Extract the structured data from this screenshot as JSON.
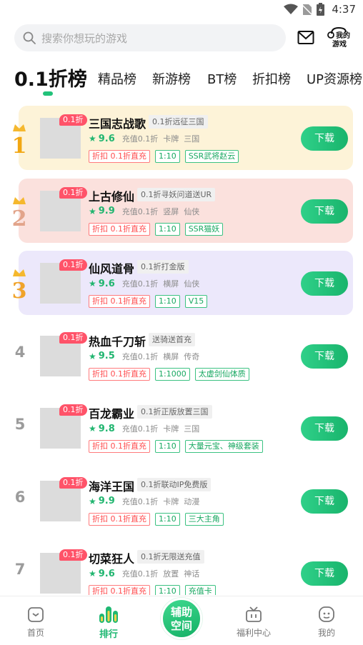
{
  "status": {
    "time": "4:37"
  },
  "search": {
    "placeholder": "搜索你想玩的游戏"
  },
  "header": {
    "my_games_line1": "我的",
    "my_games_line2": "游戏"
  },
  "tabs": [
    {
      "label": "0.1折榜",
      "active": true
    },
    {
      "label": "精品榜"
    },
    {
      "label": "新游榜"
    },
    {
      "label": "BT榜"
    },
    {
      "label": "折扣榜"
    },
    {
      "label": "UP资源榜"
    }
  ],
  "games": [
    {
      "rank": "1",
      "badge": "0.1折",
      "name": "三国志战歌",
      "subtitle": "0.1折远征三国",
      "score": "9.6",
      "meta": [
        "充值0.1折",
        "卡牌",
        "三国"
      ],
      "tags": [
        {
          "text": "折扣 0.1折直充",
          "color": "red"
        },
        {
          "text": "1:10",
          "color": "green"
        },
        {
          "text": "SSR武将赵云",
          "color": "green"
        }
      ],
      "button": "下载"
    },
    {
      "rank": "2",
      "badge": "0.1折",
      "name": "上古修仙",
      "subtitle": "0.1折寻妖问道送UR",
      "score": "9.9",
      "meta": [
        "充值0.1折",
        "竖屏",
        "仙侠"
      ],
      "tags": [
        {
          "text": "折扣 0.1折直充",
          "color": "red"
        },
        {
          "text": "1:10",
          "color": "green"
        },
        {
          "text": "SSR猫妖",
          "color": "green"
        }
      ],
      "button": "下载"
    },
    {
      "rank": "3",
      "badge": "0.1折",
      "name": "仙风道骨",
      "subtitle": "0.1折打金版",
      "score": "9.6",
      "meta": [
        "充值0.1折",
        "横屏",
        "仙侠"
      ],
      "tags": [
        {
          "text": "折扣 0.1折直充",
          "color": "red"
        },
        {
          "text": "1:10",
          "color": "green"
        },
        {
          "text": "V15",
          "color": "green"
        }
      ],
      "button": "下载"
    },
    {
      "rank": "4",
      "badge": "0.1折",
      "name": "热血千刀斩",
      "subtitle": "送骑送首充",
      "score": "9.5",
      "meta": [
        "充值0.1折",
        "横屏",
        "传奇"
      ],
      "tags": [
        {
          "text": "折扣 0.1折直充",
          "color": "red"
        },
        {
          "text": "1:1000",
          "color": "green"
        },
        {
          "text": "太虚剑仙体质",
          "color": "green"
        }
      ],
      "button": "下载"
    },
    {
      "rank": "5",
      "badge": "0.1折",
      "name": "百龙霸业",
      "subtitle": "0.1折正版放置三国",
      "score": "9.8",
      "meta": [
        "充值0.1折",
        "卡牌",
        "三国"
      ],
      "tags": [
        {
          "text": "折扣 0.1折直充",
          "color": "red"
        },
        {
          "text": "1:10",
          "color": "green"
        },
        {
          "text": "大量元宝、神级套装",
          "color": "green"
        }
      ],
      "button": "下载"
    },
    {
      "rank": "6",
      "badge": "0.1折",
      "name": "海洋王国",
      "subtitle": "0.1折联动IP免费版",
      "score": "9.9",
      "meta": [
        "充值0.1折",
        "卡牌",
        "动漫"
      ],
      "tags": [
        {
          "text": "折扣 0.1折直充",
          "color": "red"
        },
        {
          "text": "1:10",
          "color": "green"
        },
        {
          "text": "三大主角",
          "color": "green"
        }
      ],
      "button": "下载"
    },
    {
      "rank": "7",
      "badge": "0.1折",
      "name": "切菜狂人",
      "subtitle": "0.1折无限送充值",
      "score": "9.6",
      "meta": [
        "充值0.1折",
        "放置",
        "神话"
      ],
      "tags": [
        {
          "text": "折扣 0.1折直充",
          "color": "red"
        },
        {
          "text": "1:10",
          "color": "green"
        },
        {
          "text": "充值卡",
          "color": "green"
        }
      ],
      "button": "下载"
    }
  ],
  "top3_colors": [
    "#fdf3d8",
    "#fbe1dd",
    "#ece8fb"
  ],
  "accent": "#1fb872",
  "nav": {
    "home": "首页",
    "ranking": "排行",
    "assist_line1": "辅助",
    "assist_line2": "空间",
    "welfare": "福利中心",
    "mine": "我的"
  }
}
